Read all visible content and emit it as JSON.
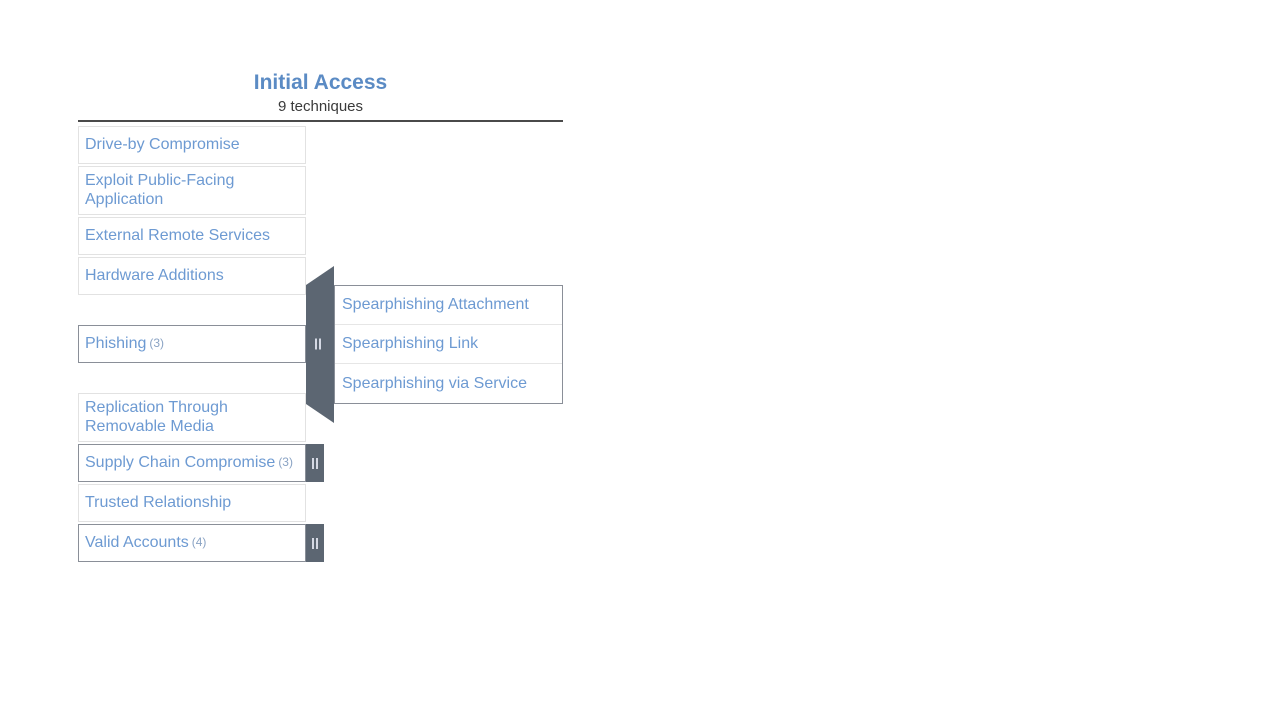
{
  "tactic": {
    "name": "Initial Access",
    "technique_count_label": "9 techniques",
    "name_color": "#5b8bc4",
    "text_color": "#6d9ad2",
    "toggle_color": "#5c6672",
    "border_color": "#8a8f98"
  },
  "techniques": [
    {
      "name": "Drive-by Compromise",
      "subtechnique_count": "",
      "expandable": false,
      "expanded": false
    },
    {
      "name": "Exploit Public-Facing Application",
      "subtechnique_count": "",
      "expandable": false,
      "expanded": false
    },
    {
      "name": "External Remote Services",
      "subtechnique_count": "",
      "expandable": false,
      "expanded": false
    },
    {
      "name": "Hardware Additions",
      "subtechnique_count": "",
      "expandable": false,
      "expanded": false
    },
    {
      "name": "Phishing",
      "subtechnique_count": "(3)",
      "expandable": true,
      "expanded": true
    },
    {
      "name": "Replication Through Removable Media",
      "subtechnique_count": "",
      "expandable": false,
      "expanded": false
    },
    {
      "name": "Supply Chain Compromise",
      "subtechnique_count": "(3)",
      "expandable": true,
      "expanded": false
    },
    {
      "name": "Trusted Relationship",
      "subtechnique_count": "",
      "expandable": false,
      "expanded": false
    },
    {
      "name": "Valid Accounts",
      "subtechnique_count": "(4)",
      "expandable": true,
      "expanded": false
    }
  ],
  "expanded_subtechniques": {
    "parent": "Phishing",
    "items": [
      {
        "name": "Spearphishing Attachment"
      },
      {
        "name": "Spearphishing Link"
      },
      {
        "name": "Spearphishing via Service"
      }
    ]
  },
  "icons": {
    "toggle": "pause-bars-icon"
  }
}
